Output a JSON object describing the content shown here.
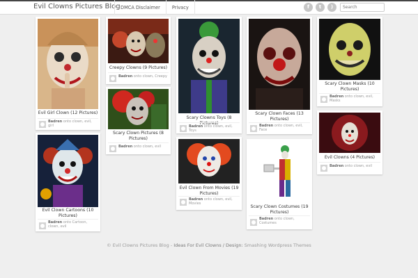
{
  "header": {
    "brand": "Evil Clowns Pictures Blog",
    "nav": [
      "DMCA Disclaimer",
      "Privacy"
    ],
    "search_placeholder": "Search",
    "social_icons": [
      "facebook-icon",
      "twitter-icon",
      "rss-icon"
    ]
  },
  "cards": [
    {
      "title": "Evil Girl Clown (12 Pictures)",
      "author": "Badren",
      "posted_word": "onto",
      "tags": "clown, evil, girl"
    },
    {
      "title": "Evil Clown Cartoons (10 Pictures)",
      "author": "Badren",
      "posted_word": "onto",
      "tags": "Cartoon, clown, evil"
    },
    {
      "title": "Creepy Clowns (9 Pictures)",
      "author": "Badren",
      "posted_word": "onto",
      "tags": "clown, Creepy"
    },
    {
      "title": "Scary Clown Pictures (8 Pictures)",
      "author": "Badren",
      "posted_word": "onto",
      "tags": "clown, evil"
    },
    {
      "title": "Scary Clowns Toys (8 Pictures)",
      "author": "Badren",
      "posted_word": "onto",
      "tags": "clown, evil, Toys"
    },
    {
      "title": "Evil Clown From Movies (19 Pictures)",
      "author": "Badren",
      "posted_word": "onto",
      "tags": "clown, evil, Movies"
    },
    {
      "title": "Scary Clown Faces (13 Pictures)",
      "author": "Badren",
      "posted_word": "onto",
      "tags": "clown, evil, Face"
    },
    {
      "title": "Scary Clown Costumes (19 Pictures)",
      "author": "Badren",
      "posted_word": "onto",
      "tags": "clown, Costumes"
    },
    {
      "title": "Scary Clown Masks (10 Pictures)",
      "author": "Badren",
      "posted_word": "onto",
      "tags": "clown, evil, Masks"
    },
    {
      "title": "Evil Clowns (4 Pictures)",
      "author": "Badren",
      "posted_word": "onto",
      "tags": "clown, evil"
    }
  ],
  "footer": {
    "copyright": "© Evil Clowns Pictures Blog -",
    "tagline": "Ideas For Evil Clowns / Design:",
    "credit": "Smashing Wordpress Themes"
  }
}
